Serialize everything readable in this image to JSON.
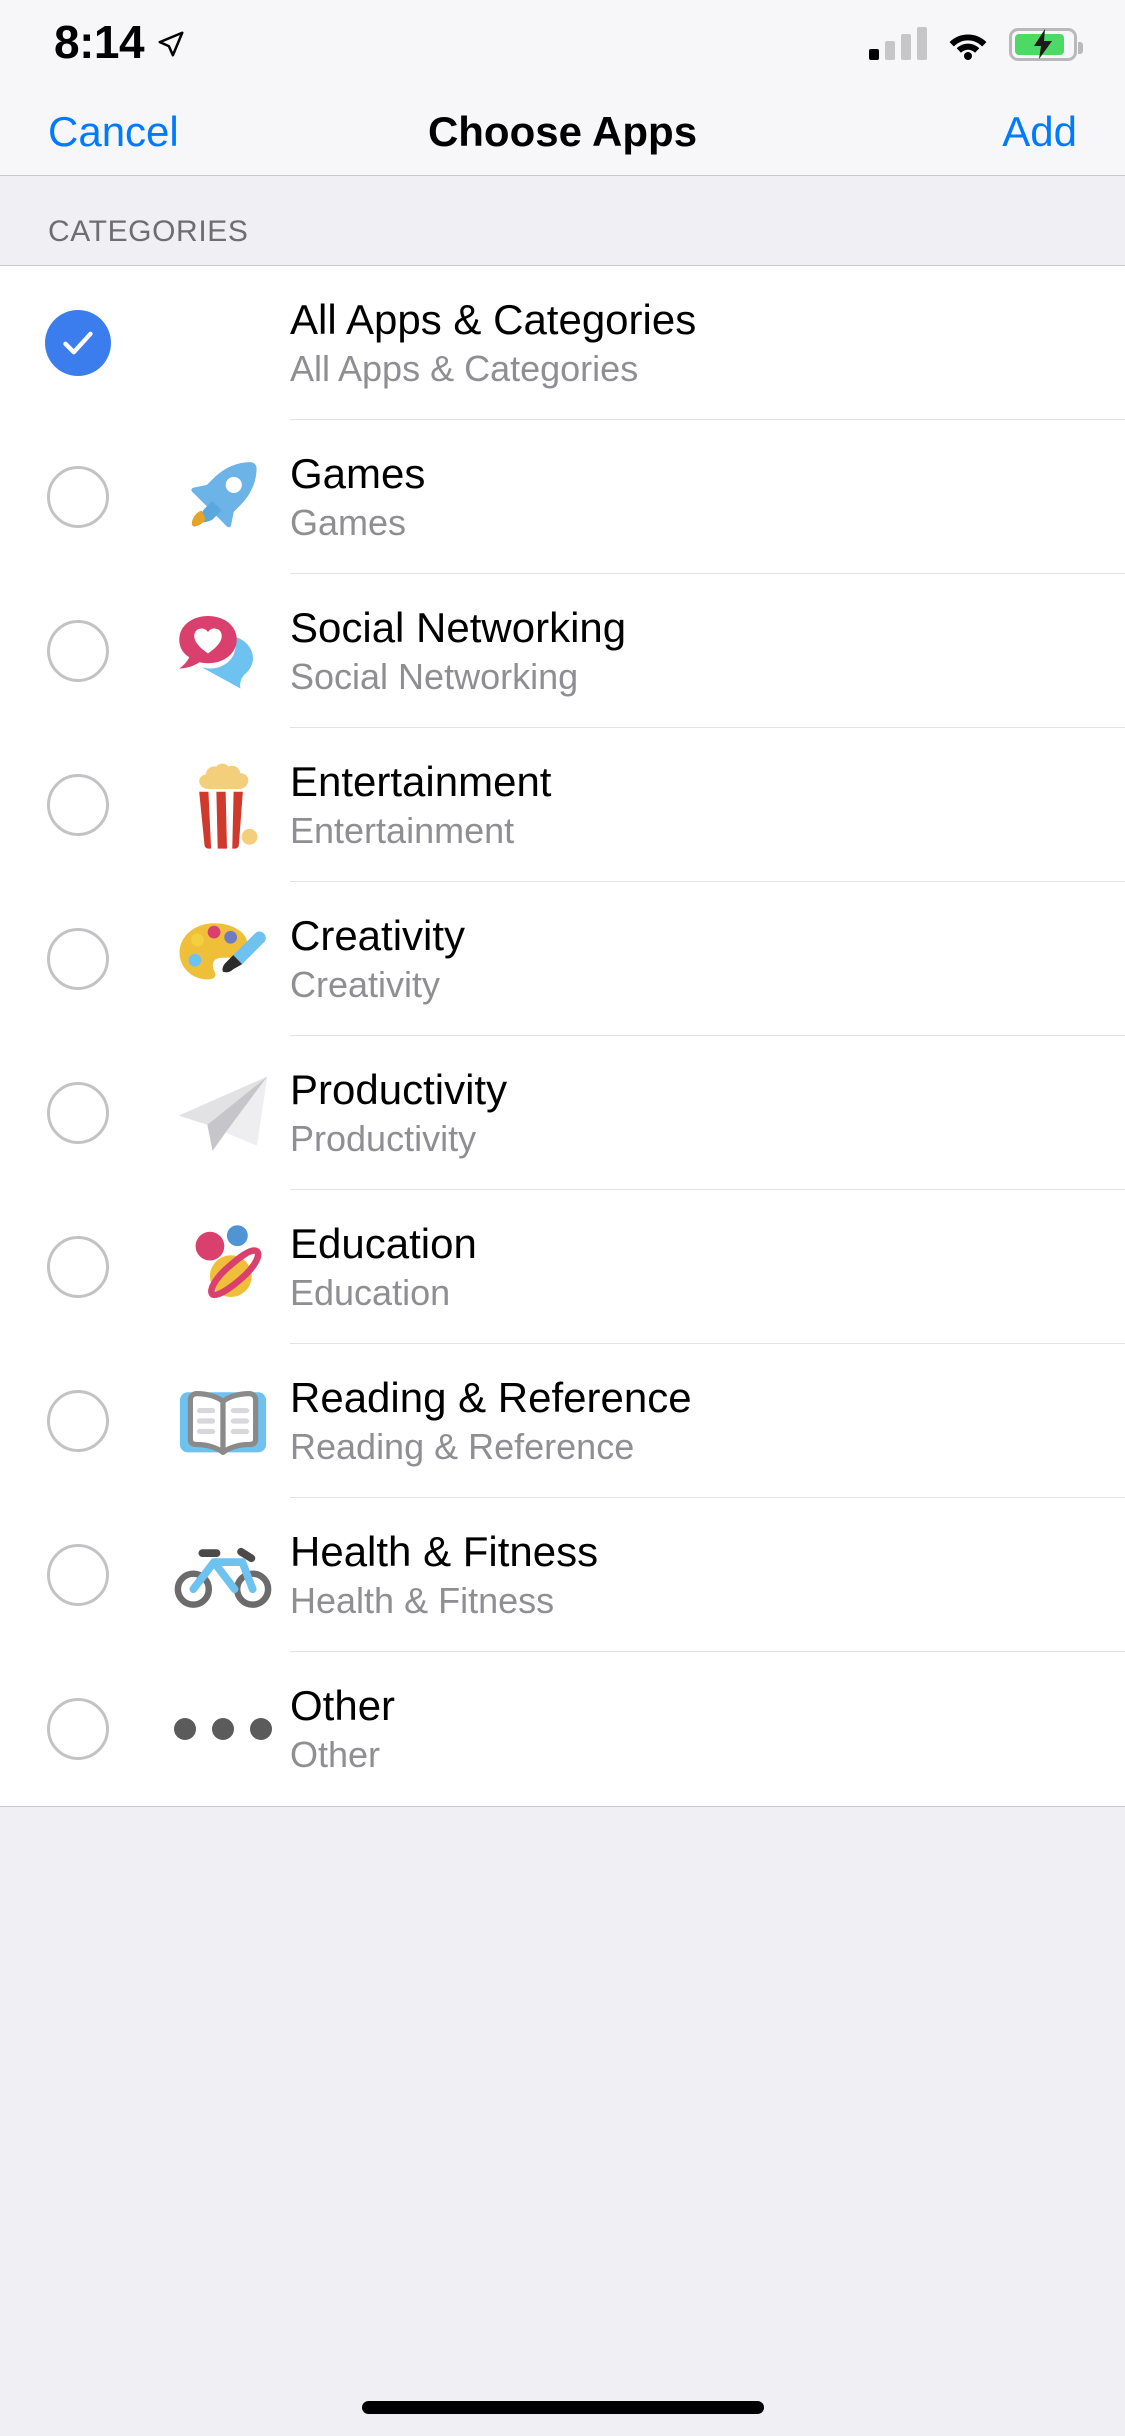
{
  "status_bar": {
    "time": "8:14",
    "location_icon": "location-arrow-icon",
    "signal_icon": "cellular-signal-icon",
    "signal_bars_filled": 1,
    "signal_bars_total": 4,
    "wifi_icon": "wifi-icon",
    "battery_icon": "battery-charging-icon",
    "battery_level_percent": 88,
    "battery_charging": true,
    "colors": {
      "battery_green": "#4cd964",
      "filled_bar": "#000000",
      "empty_bar": "#c6c6c9"
    }
  },
  "nav_bar": {
    "cancel_label": "Cancel",
    "title": "Choose Apps",
    "add_label": "Add",
    "tint_color": "#007aff"
  },
  "section": {
    "header": "CATEGORIES"
  },
  "list": {
    "selected_index": 0,
    "selected_color": "#3b7ded",
    "rows": [
      {
        "title": "All Apps & Categories",
        "subtitle": "All Apps & Categories",
        "icon": "none",
        "selected": true
      },
      {
        "title": "Games",
        "subtitle": "Games",
        "icon": "rocket-icon",
        "selected": false
      },
      {
        "title": "Social Networking",
        "subtitle": "Social Networking",
        "icon": "speech-balloon-heart-icon",
        "selected": false
      },
      {
        "title": "Entertainment",
        "subtitle": "Entertainment",
        "icon": "popcorn-icon",
        "selected": false
      },
      {
        "title": "Creativity",
        "subtitle": "Creativity",
        "icon": "artist-palette-icon",
        "selected": false
      },
      {
        "title": "Productivity",
        "subtitle": "Productivity",
        "icon": "paper-plane-icon",
        "selected": false
      },
      {
        "title": "Education",
        "subtitle": "Education",
        "icon": "planet-icon",
        "selected": false
      },
      {
        "title": "Reading & Reference",
        "subtitle": "Reading & Reference",
        "icon": "open-book-icon",
        "selected": false
      },
      {
        "title": "Health & Fitness",
        "subtitle": "Health & Fitness",
        "icon": "bicycle-icon",
        "selected": false
      },
      {
        "title": "Other",
        "subtitle": "Other",
        "icon": "ellipsis-icon",
        "selected": false
      }
    ]
  },
  "home_indicator": {
    "name": "home-indicator"
  }
}
